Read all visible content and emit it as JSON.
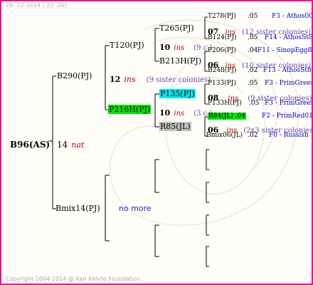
{
  "header": {
    "date": "28- 12-2014 ( 22: 20)"
  },
  "footer": {
    "copyright": "Copyright 2004-2014 @ Karl Kehrle Foundation."
  },
  "root": {
    "name": "B96(AS)",
    "num": "14",
    "tag": "nat"
  },
  "gen1": {
    "father": {
      "name": "B290(PJ)",
      "num": "12",
      "tag": "ins",
      "sisters": "(9 sister colonies)"
    },
    "mother": {
      "name": "Bmix14(PJ)",
      "note": "no more"
    }
  },
  "gen2": {
    "ff": {
      "name": "T120(PJ)"
    },
    "fm": {
      "name": "P216H(PJ)",
      "num": "10",
      "tag": "ins",
      "sisters": "(3 c.)"
    }
  },
  "gen3": {
    "fff": {
      "name": "T265(PJ)",
      "num": "10",
      "tag": "ins",
      "sisters": "(9 c.)"
    },
    "ffm": {
      "name": "B213H(PJ)"
    },
    "fmf": {
      "name": "P135(PJ)"
    },
    "fmm": {
      "name": "R85(JL)"
    }
  },
  "gen4": [
    {
      "name": "T278(PJ)",
      "score": ".05",
      "ref": "F3 - Athos00R"
    },
    {
      "num": "07",
      "tag": "ins",
      "sisters": "(12 sister colonies)"
    },
    {
      "name": "B124(PJ)",
      "score": ".05",
      "ref": "F14 - AthosSt80R"
    },
    {
      "name": "P206(PJ)",
      "score": ".04",
      "ref": "F11 - SinopEgg86R"
    },
    {
      "num": "06",
      "tag": "ins",
      "sisters": "(10 sister colonies)"
    },
    {
      "name": "B248(PJ)",
      "score": ".02",
      "ref": "F13 - AthosSt80R"
    },
    {
      "name": "P133(PJ)",
      "score": ".05",
      "ref": "F3 - PrimGreen00"
    },
    {
      "num": "08",
      "tag": "ins",
      "sisters": "(9 sister colonies)"
    },
    {
      "name": "P133H(PJ)",
      "score": ".05",
      "ref": "F3 - PrimGreen00"
    },
    {
      "name": "R84(JL)",
      "score": ".04",
      "ref": "F2 - PrimRed01"
    },
    {
      "num": "06",
      "tag": "ins",
      "sisters": "(2x3 sister colonies)"
    },
    {
      "name": "Bmix06(JL)",
      "score": ".02",
      "ref": "F0 - Russish"
    }
  ],
  "colors": {
    "frame": "#e8148c",
    "ins": "#c00000",
    "sisters": "#6a3fb0",
    "ref": "#0000c8",
    "highlight_green": "#00e600",
    "highlight_cyan": "#00e8f0",
    "highlight_gray": "#c0c0c0"
  }
}
